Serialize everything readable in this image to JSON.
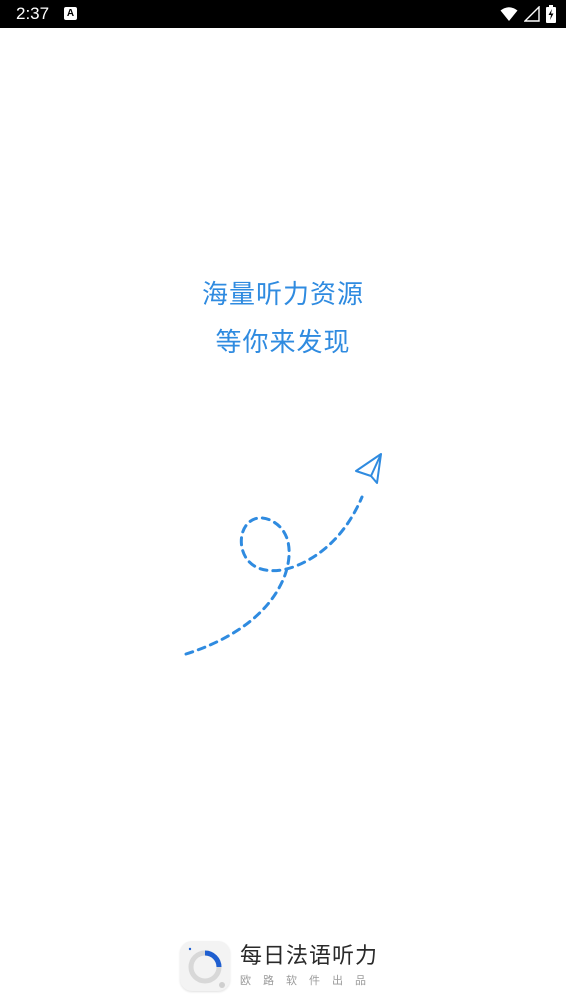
{
  "status_bar": {
    "time": "2:37",
    "notification_icon": "A",
    "icons": [
      "wifi-icon",
      "signal-icon",
      "battery-charging-icon"
    ]
  },
  "slogan": {
    "line1": "海量听力资源",
    "line2": "等你来发现"
  },
  "illustration": {
    "icons": [
      "paper-plane-icon",
      "dashed-loop-path"
    ],
    "accent_color": "#2f8be0"
  },
  "brand": {
    "logo_icon": "app-logo-icon",
    "name": "每日法语听力",
    "subtitle": "欧路软件出品"
  }
}
